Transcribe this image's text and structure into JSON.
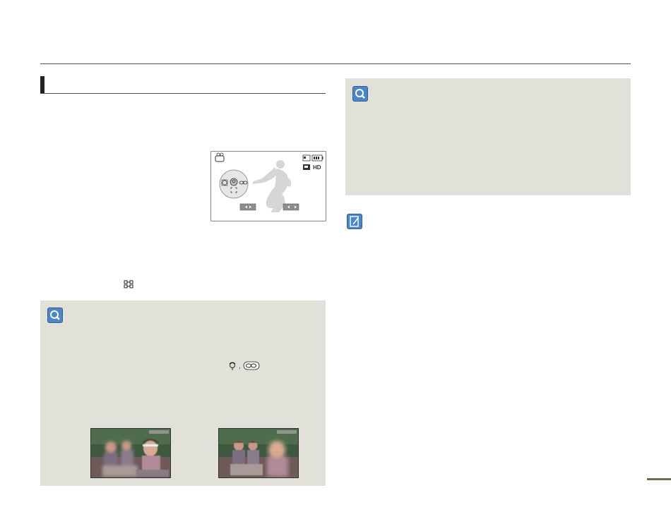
{
  "page": {
    "accent_color": "#4b86c5",
    "panel_color": "#e1e0d9",
    "rule_color": "#555555"
  },
  "lcd": {
    "mode_icon": "camcorder-icon",
    "battery_icon": "battery-icon",
    "card_icon": "memory-card-icon",
    "quality_label": "HD",
    "focus_options": [
      "face-detection-icon",
      "macro-icon",
      "infinity-icon"
    ],
    "focus_frame_icon": "focus-frame-icon",
    "buttons": [
      "< ▶",
      "← →"
    ]
  },
  "inline_icons": {
    "focus_symbol": "⌗",
    "macro_symbol": "⚘",
    "infinity_symbol": "∞"
  },
  "icons": {
    "tip_left": "magnifier-icon",
    "tip_right": "magnifier-icon",
    "note": "note-pencil-icon"
  }
}
